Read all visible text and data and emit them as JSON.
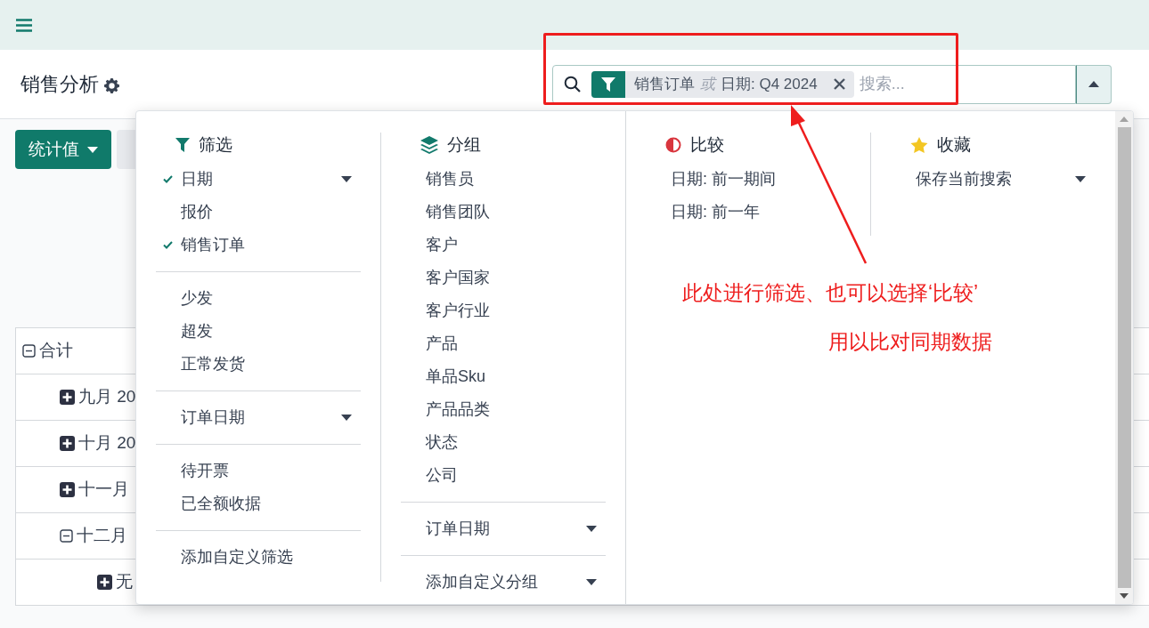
{
  "title": "销售分析",
  "search": {
    "facet": {
      "values": [
        "销售订单",
        "日期: Q4 2024"
      ],
      "separator": "或"
    },
    "placeholder": "搜索...",
    "panel_open": true
  },
  "measure_button": "统计值",
  "table": {
    "rows": [
      {
        "label": "合计",
        "expanded": true,
        "children": [
          {
            "label": "九月 20",
            "expanded": false
          },
          {
            "label": "十月 20",
            "expanded": false
          },
          {
            "label": "十一月",
            "expanded": false
          },
          {
            "label": "十二月",
            "expanded": true,
            "children": [
              {
                "label": "无",
                "expanded": false
              }
            ]
          }
        ]
      }
    ]
  },
  "menu": {
    "filters": {
      "title": "筛选",
      "groups": [
        [
          {
            "label": "日期",
            "checked": true,
            "expandable": true
          },
          {
            "label": "报价",
            "checked": false,
            "expandable": false
          },
          {
            "label": "销售订单",
            "checked": true,
            "expandable": false
          }
        ],
        [
          {
            "label": "少发",
            "checked": false,
            "expandable": false
          },
          {
            "label": "超发",
            "checked": false,
            "expandable": false
          },
          {
            "label": "正常发货",
            "checked": false,
            "expandable": false
          }
        ],
        [
          {
            "label": "订单日期",
            "checked": false,
            "expandable": true
          }
        ],
        [
          {
            "label": "待开票",
            "checked": false,
            "expandable": false
          },
          {
            "label": "已全额收据",
            "checked": false,
            "expandable": false
          }
        ],
        [
          {
            "label": "添加自定义筛选",
            "checked": false,
            "expandable": false
          }
        ]
      ]
    },
    "group_by": {
      "title": "分组",
      "groups": [
        [
          {
            "label": "销售员",
            "expandable": false
          },
          {
            "label": "销售团队",
            "expandable": false
          },
          {
            "label": "客户",
            "expandable": false
          },
          {
            "label": "客户国家",
            "expandable": false
          },
          {
            "label": "客户行业",
            "expandable": false
          },
          {
            "label": "产品",
            "expandable": false
          },
          {
            "label": "单品Sku",
            "expandable": false
          },
          {
            "label": "产品品类",
            "expandable": false
          },
          {
            "label": "状态",
            "expandable": false
          },
          {
            "label": "公司",
            "expandable": false
          }
        ],
        [
          {
            "label": "订单日期",
            "expandable": true
          }
        ],
        [
          {
            "label": "添加自定义分组",
            "expandable": true
          }
        ]
      ]
    },
    "comparison": {
      "title": "比较",
      "items": [
        "日期: 前一期间",
        "日期: 前一年"
      ]
    },
    "favorites": {
      "title": "收藏",
      "items": [
        {
          "label": "保存当前搜索",
          "expandable": true
        }
      ]
    }
  },
  "annotation": {
    "lines": [
      "此处进行筛选、也可以选择‘比较’",
      "用以比对同期数据"
    ]
  }
}
